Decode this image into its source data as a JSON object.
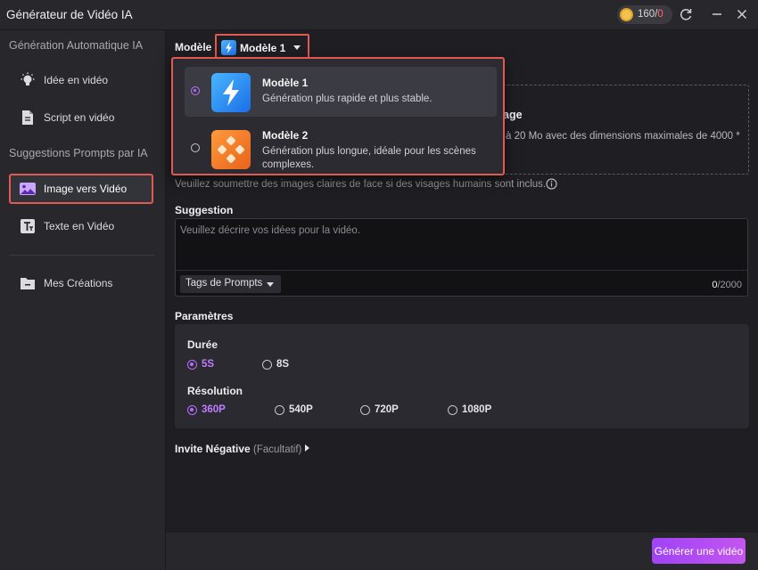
{
  "window": {
    "title": "Générateur de Vidéo IA",
    "credits_used": "160",
    "credits_separator": "/",
    "credits_total": "0"
  },
  "sidebar": {
    "section_auto": "Génération Automatique IA",
    "items_auto": [
      {
        "label": "Idée en vidéo",
        "icon": "lightbulb-icon"
      },
      {
        "label": "Script en vidéo",
        "icon": "document-icon"
      }
    ],
    "section_prompts": "Suggestions Prompts par IA",
    "items_prompts": [
      {
        "label": "Image vers Vidéo",
        "icon": "image-icon",
        "active": true
      },
      {
        "label": "Texte en Vidéo",
        "icon": "text-icon"
      }
    ],
    "creations": {
      "label": "Mes Créations",
      "icon": "folder-icon"
    }
  },
  "model": {
    "label": "Modèle",
    "selected": "Modèle 1",
    "options": [
      {
        "name": "Modèle 1",
        "description": "Génération plus rapide et plus stable.",
        "selected": true,
        "icon": "lightning-icon",
        "color": "#2f8df5"
      },
      {
        "name": "Modèle 2",
        "description": "Génération plus longue, idéale pour les scènes complexes.",
        "selected": false,
        "icon": "diamond-tiles-icon",
        "color": "#f07a1e"
      }
    ]
  },
  "upload": {
    "title_partial": "age",
    "desc_partial": "à 20 Mo avec des dimensions maximales de 4000 *",
    "note_partial": "Veuillez soumettre des images claires de face si des visages humains sont inclus."
  },
  "suggestion": {
    "label": "Suggestion",
    "placeholder": "Veuillez décrire vos idées pour la vidéo.",
    "tags_button": "Tags de Prompts",
    "count": "0",
    "max": "/2000"
  },
  "params": {
    "label": "Paramètres",
    "duration_label": "Durée",
    "durations": [
      {
        "label": "5S",
        "checked": true
      },
      {
        "label": "8S",
        "checked": false
      }
    ],
    "resolution_label": "Résolution",
    "resolutions": [
      {
        "label": "360P",
        "checked": true
      },
      {
        "label": "540P",
        "checked": false
      },
      {
        "label": "720P",
        "checked": false
      },
      {
        "label": "1080P",
        "checked": false
      }
    ]
  },
  "negative": {
    "label": "Invite Négative",
    "optional": "(Facultatif)"
  },
  "footer": {
    "generate_button": "Générer une vidéo"
  },
  "colors": {
    "accent": "#b86cff",
    "highlight_border": "#e05a52",
    "generate_gradient_start": "#9f43f5",
    "generate_gradient_end": "#c455f0"
  }
}
